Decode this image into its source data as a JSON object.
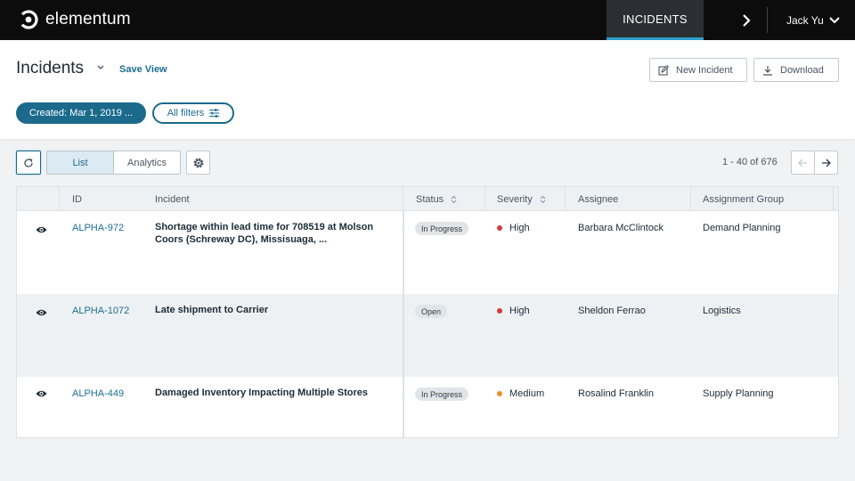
{
  "app": {
    "logo_text": "elementum",
    "nav_tab": "INCIDENTS",
    "user_name": "Jack Yu"
  },
  "header": {
    "title": "Incidents",
    "save_view": "Save View",
    "new_incident": "New Incident",
    "download": "Download",
    "filter_created": "Created: Mar 1, 2019 ...",
    "filter_all": "All filters"
  },
  "toolbar": {
    "view_list": "List",
    "view_analytics": "Analytics",
    "pagination": "1 - 40 of 676"
  },
  "table": {
    "columns": {
      "id": "ID",
      "incident": "Incident",
      "status": "Status",
      "severity": "Severity",
      "assignee": "Assignee",
      "group": "Assignment Group"
    },
    "rows": [
      {
        "id": "ALPHA-972",
        "incident": "Shortage within lead time for 708519 at Molson Coors (Schreway DC), Missisuaga, ...",
        "status": "In Progress",
        "severity": "High",
        "severity_color": "#d63b3b",
        "assignee": "Barbara McClintock",
        "group": "Demand Planning"
      },
      {
        "id": "ALPHA-1072",
        "incident": "Late shipment to Carrier",
        "status": "Open",
        "severity": "High",
        "severity_color": "#d63b3b",
        "assignee": "Sheldon Ferrao",
        "group": "Logistics"
      },
      {
        "id": "ALPHA-449",
        "incident": "Damaged Inventory Impacting Multiple Stores",
        "status": "In Progress",
        "severity": "Medium",
        "severity_color": "#ef8c2a",
        "assignee": "Rosalind Franklin",
        "group": "Supply Planning"
      }
    ]
  },
  "colors": {
    "accent": "#1b6a8c",
    "link": "#1c6d93",
    "topbar": "#0c0c0d",
    "active_tab_underline": "#2e9fc9"
  },
  "icons": {
    "logo": "elementum-logo-icon",
    "nav_arrow": "chevron-right-icon",
    "user_menu": "chevron-down-icon",
    "new_incident": "edit-icon",
    "download": "download-icon",
    "filters": "sliders-icon",
    "refresh": "refresh-icon",
    "settings": "gear-icon",
    "row_view": "eye-icon"
  }
}
